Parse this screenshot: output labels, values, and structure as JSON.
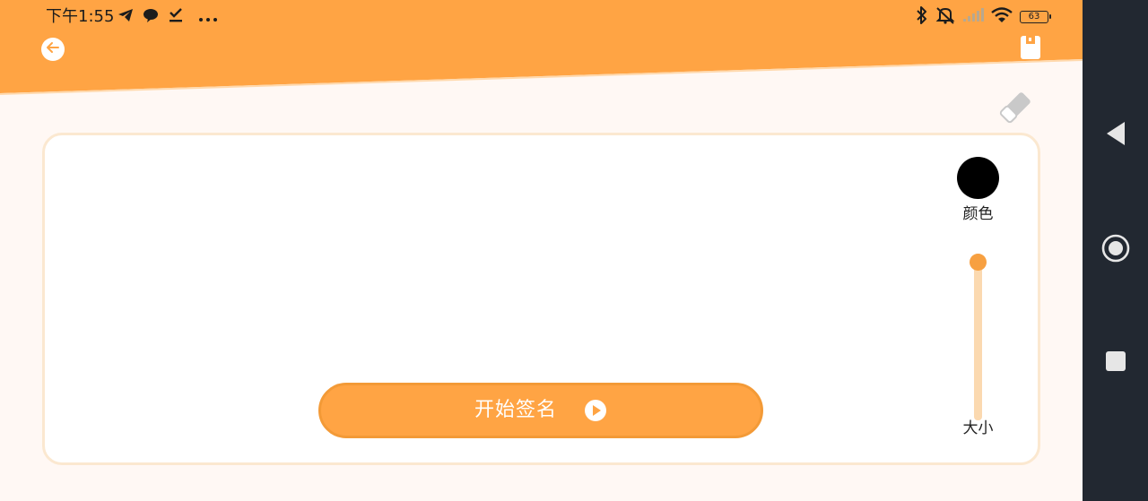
{
  "status_bar": {
    "time": "下午1:55",
    "left_icons": [
      "telegram-icon",
      "chat-bubble-icon",
      "download-done-icon",
      "more-dots-icon"
    ],
    "right_icons": [
      "bluetooth-icon",
      "mute-icon",
      "signal-icon",
      "wifi-icon"
    ],
    "battery": "63"
  },
  "header": {
    "back_icon": "arrow-left-icon",
    "save_icon": "save-icon",
    "accent_color": "#ffa444"
  },
  "toolbar": {
    "eraser_icon": "eraser-icon"
  },
  "brush": {
    "color_label": "颜色",
    "current_color": "#000000",
    "size_label": "大小"
  },
  "start_button": {
    "label": "开始签名",
    "icon": "play-icon"
  },
  "nav_bar": {
    "back_icon": "nav-back-icon",
    "home_icon": "nav-home-icon",
    "recents_icon": "nav-recents-icon"
  }
}
